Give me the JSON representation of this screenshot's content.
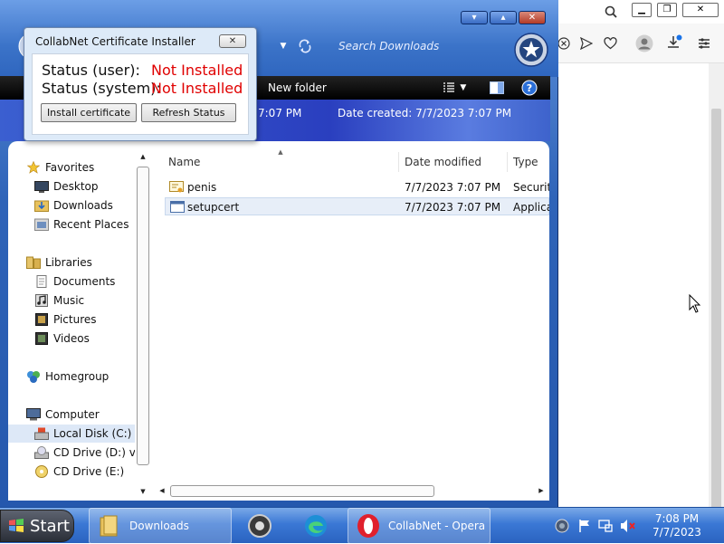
{
  "explorer": {
    "search_placeholder": "Search Downloads",
    "toolbar": {
      "new_folder": "New folder"
    },
    "details": {
      "modified_partial": "7:07 PM",
      "created_label": "Date created:",
      "created_value": "7/7/2023 7:07 PM"
    },
    "nav": {
      "favorites": "Favorites",
      "desktop": "Desktop",
      "downloads": "Downloads",
      "recent_places": "Recent Places",
      "libraries": "Libraries",
      "documents": "Documents",
      "music": "Music",
      "pictures": "Pictures",
      "videos": "Videos",
      "homegroup": "Homegroup",
      "computer": "Computer",
      "local_disk": "Local Disk (C:)",
      "cd_drive_d": "CD Drive (D:) virt",
      "cd_drive_e": "CD Drive (E:)"
    },
    "columns": {
      "name": "Name",
      "date_modified": "Date modified",
      "type": "Type"
    },
    "files": [
      {
        "name": "penis",
        "date": "7/7/2023 7:07 PM",
        "type": "Security"
      },
      {
        "name": "setupcert",
        "date": "7/7/2023 7:07 PM",
        "type": "Applica"
      }
    ]
  },
  "dialog": {
    "title": "CollabNet Certificate Installer",
    "status_user_label": "Status (user):",
    "status_user_value": "Not Installed",
    "status_system_label": "Status (system):",
    "status_system_value": "Not Installed",
    "install_button": "Install certificate",
    "refresh_button": "Refresh Status",
    "status_color": "#e00000"
  },
  "taskbar": {
    "start_label": "Start",
    "items": [
      {
        "label": "Downloads"
      },
      {
        "label": "CollabNet - Opera"
      }
    ],
    "clock": {
      "time": "7:08 PM",
      "date": "7/7/2023"
    }
  },
  "icons": {
    "explorer": [
      "back-icon",
      "dropdown-icon",
      "refresh-icon",
      "windows-media-icon",
      "views-icon",
      "preview-pane-icon",
      "help-icon"
    ],
    "browser": [
      "search-icon",
      "close-tab-icon",
      "send-icon",
      "heart-icon",
      "profile-icon",
      "download-icon",
      "menu-icon"
    ],
    "tray": [
      "network-icon",
      "flag-icon",
      "monitor-icon",
      "volume-muted-icon"
    ]
  }
}
